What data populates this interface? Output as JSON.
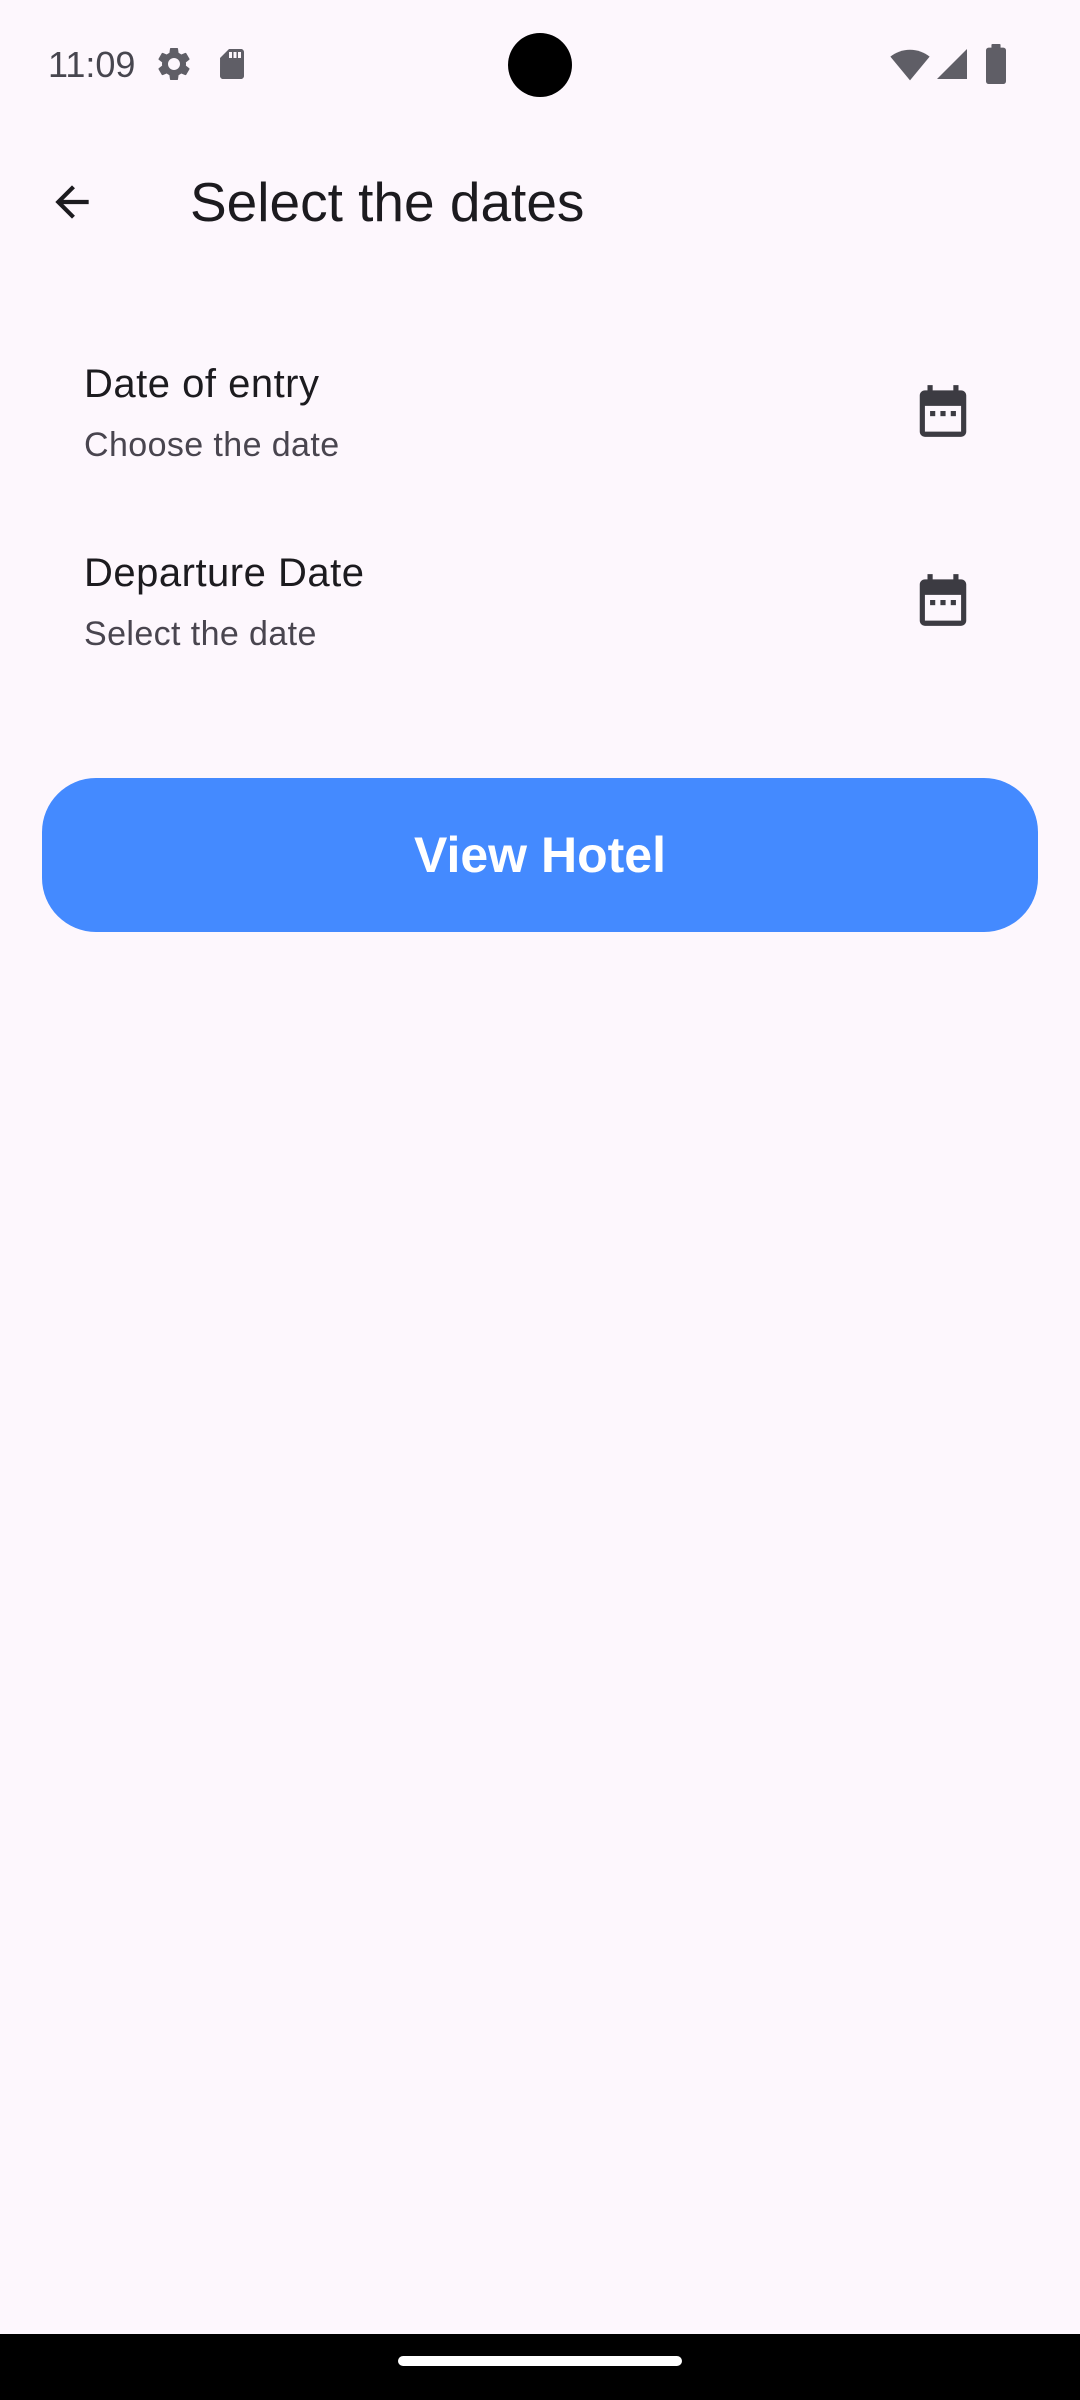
{
  "status_bar": {
    "time": "11:09",
    "icons": [
      "settings-icon",
      "sd-card-icon",
      "wifi-icon",
      "signal-icon",
      "battery-icon"
    ]
  },
  "app_bar": {
    "title": "Select the dates",
    "back_icon": "arrow-back-icon"
  },
  "dates": {
    "entry": {
      "title": "Date of entry",
      "subtitle": "Choose the date",
      "icon": "calendar-icon"
    },
    "departure": {
      "title": "Departure Date",
      "subtitle": "Select the date",
      "icon": "calendar-icon"
    }
  },
  "actions": {
    "view_hotel_label": "View Hotel"
  },
  "colors": {
    "background": "#fdf7fd",
    "primary_button": "#448aff",
    "text_primary": "#1c1b1f",
    "text_secondary": "#49454f"
  }
}
